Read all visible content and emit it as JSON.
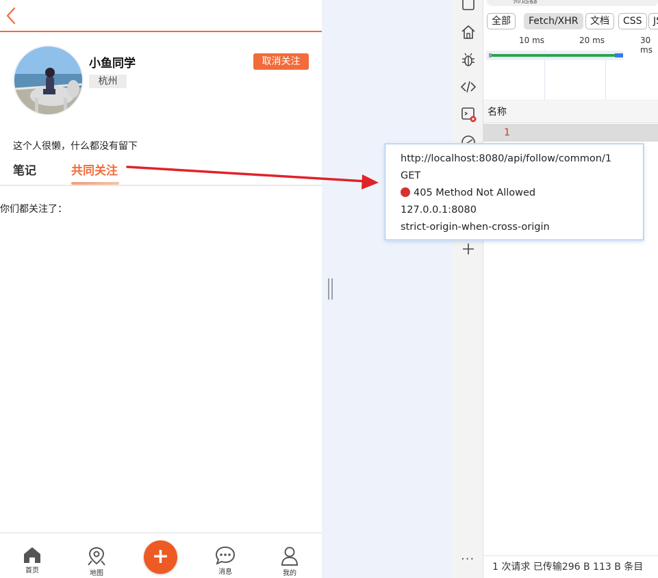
{
  "app": {
    "profile": {
      "username": "小鱼同学",
      "city": "杭州",
      "unfollow_label": "取消关注",
      "intro": "这个人很懒，什么都没有留下"
    },
    "tabs": [
      {
        "label": "笔记",
        "active": false
      },
      {
        "label": "共同关注",
        "active": true
      }
    ],
    "common_follow_label": "你们都关注了：",
    "tabbar": [
      {
        "label": "首页",
        "icon": "home-icon"
      },
      {
        "label": "地图",
        "icon": "map-pin-icon"
      },
      {
        "label": "",
        "icon": "plus-icon"
      },
      {
        "label": "消息",
        "icon": "message-icon"
      },
      {
        "label": "我的",
        "icon": "user-icon"
      }
    ],
    "accent_color": "#f26b3a"
  },
  "devtools": {
    "filter_placeholder": "筛选器",
    "filters": [
      "全部",
      "Fetch/XHR",
      "文档",
      "CSS",
      "JS"
    ],
    "active_filter": "Fetch/XHR",
    "timeline_ticks": [
      "10 ms",
      "20 ms",
      "30 ms"
    ],
    "name_column": "名称",
    "request_name": "1",
    "status_bar": "1 次请求   已传输296 B   113 B 条目",
    "tooltip": {
      "url": "http://localhost:8080/api/follow/common/1",
      "method": "GET",
      "status": "405 Method Not Allowed",
      "remote_address": "127.0.0.1:8080",
      "referrer_policy": "strict-origin-when-cross-origin",
      "status_color": "#d93030"
    }
  },
  "annotation": {
    "arrow_color": "#e0222a"
  }
}
